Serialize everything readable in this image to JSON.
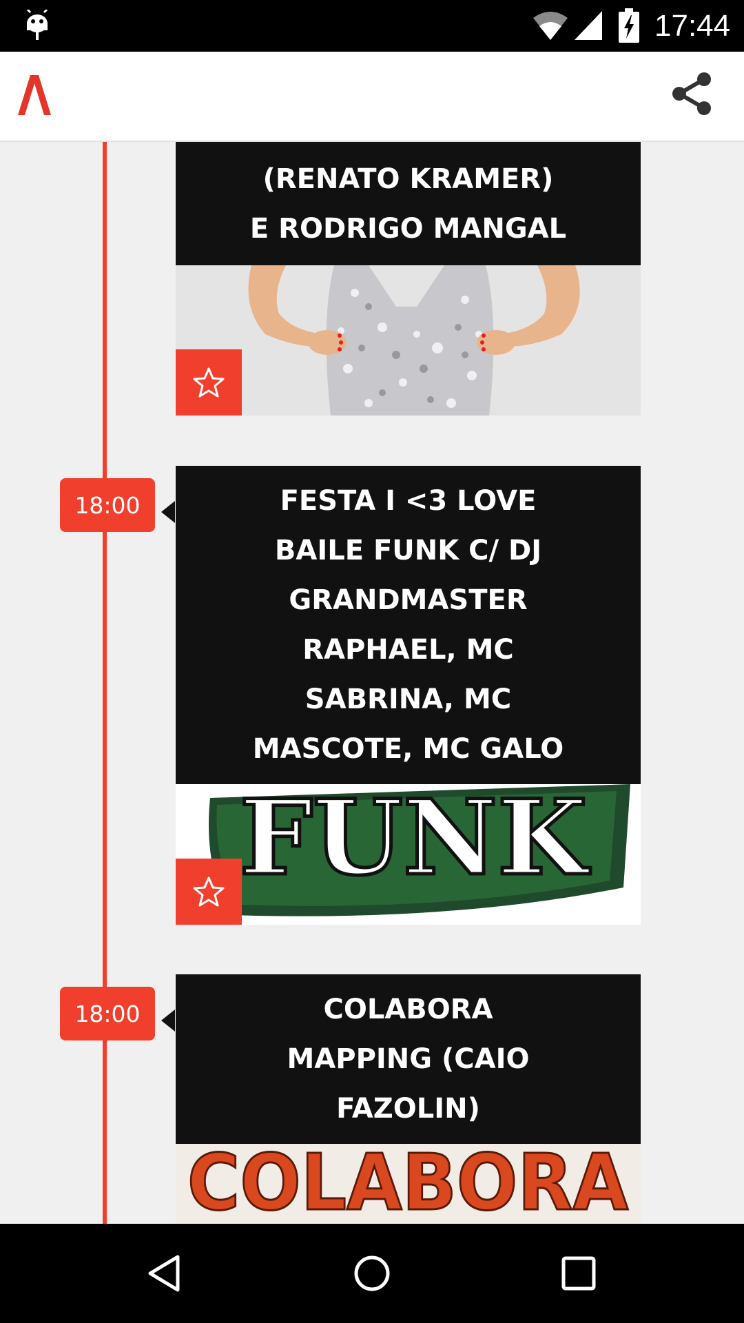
{
  "status_bar": {
    "time": "17:44",
    "icons": [
      "android-icon",
      "wifi-icon",
      "signal-icon",
      "battery-charging-icon"
    ]
  },
  "app_bar": {
    "logo_icon": "logo-icon",
    "share_icon": "share-icon",
    "accent_color": "#f0402d"
  },
  "events": [
    {
      "time": "",
      "title_lines": [
        "(RENATO KRAMER)",
        "E RODRIGO MANGAL"
      ],
      "image_icon": "dress-photo",
      "favorite_icon": "star-icon"
    },
    {
      "time": "18:00",
      "title_lines": [
        "FESTA I <3 LOVE",
        "BAILE FUNK C/ DJ",
        "GRANDMASTER",
        "RAPHAEL, MC",
        "SABRINA, MC",
        "MASCOTE, MC GALO"
      ],
      "image_text": "FUNK",
      "favorite_icon": "star-icon"
    },
    {
      "time": "18:00",
      "title_lines": [
        "COLABORA",
        "MAPPING (CAIO",
        "FAZOLIN)"
      ],
      "image_text": "COLABORA",
      "favorite_icon": "star-icon"
    }
  ],
  "nav_bar": {
    "icons": [
      "back-icon",
      "home-icon",
      "recents-icon"
    ]
  }
}
